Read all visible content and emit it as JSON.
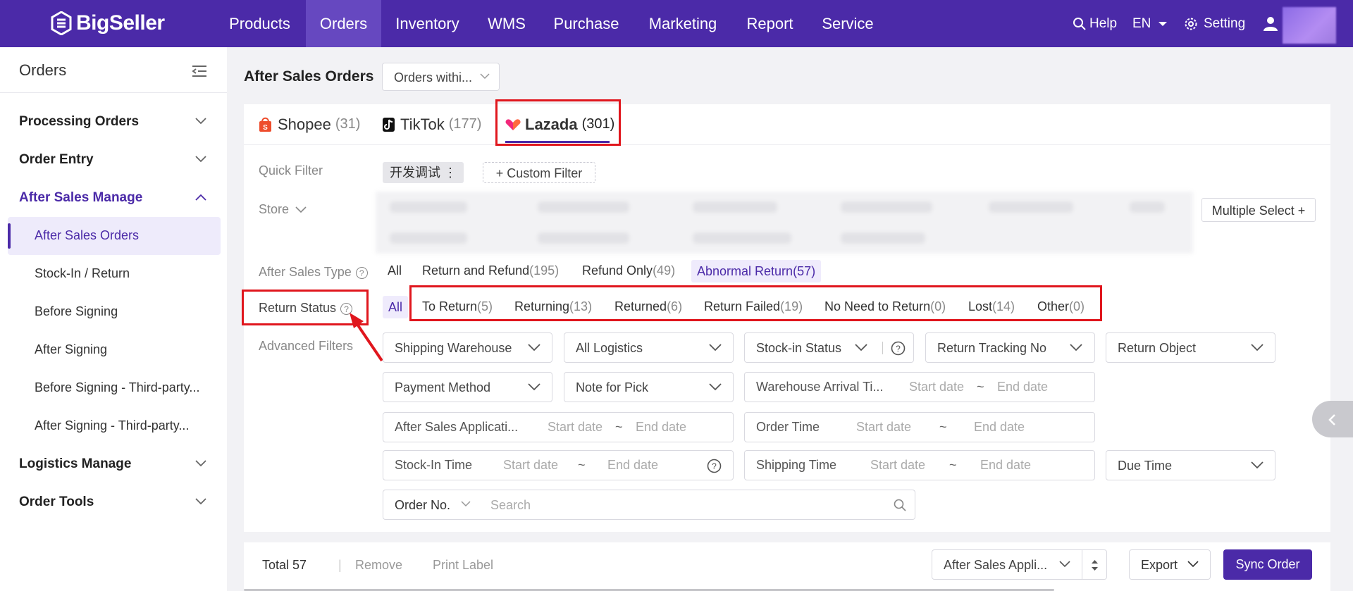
{
  "brand": {
    "name": "BigSeller"
  },
  "topnav": {
    "items": [
      {
        "label": "Products"
      },
      {
        "label": "Orders"
      },
      {
        "label": "Inventory"
      },
      {
        "label": "WMS"
      },
      {
        "label": "Purchase"
      },
      {
        "label": "Marketing"
      },
      {
        "label": "Report"
      },
      {
        "label": "Service"
      }
    ],
    "active": "Orders",
    "help": "Help",
    "lang": "EN",
    "setting": "Setting"
  },
  "sidebar": {
    "title": "Orders",
    "groups": [
      {
        "label": "Processing Orders"
      },
      {
        "label": "Order Entry"
      },
      {
        "label": "After Sales Manage"
      },
      {
        "label": "Logistics Manage"
      },
      {
        "label": "Order Tools"
      }
    ],
    "after_sales_items": [
      {
        "label": "After Sales Orders"
      },
      {
        "label": "Stock-In / Return"
      },
      {
        "label": "Before Signing"
      },
      {
        "label": "After Signing"
      },
      {
        "label": "Before Signing - Third-party..."
      },
      {
        "label": "After Signing - Third-party..."
      }
    ]
  },
  "page": {
    "title": "After Sales Orders",
    "range_select": "Orders withi...",
    "platform_tabs": [
      {
        "name": "Shopee",
        "count": "(31)"
      },
      {
        "name": "TikTok",
        "count": "(177)"
      },
      {
        "name": "Lazada",
        "count": "(301)"
      }
    ]
  },
  "filters": {
    "quick_filter_label": "Quick Filter",
    "quick_tag": "开发调试 ⋮",
    "custom_filter": "+ Custom Filter",
    "store_label": "Store",
    "multiple_select": "Multiple Select +",
    "after_sales_type_label": "After Sales Type",
    "after_sales_types": [
      {
        "label": "All",
        "count": ""
      },
      {
        "label": "Return and Refund",
        "count": "(195)"
      },
      {
        "label": "Refund Only",
        "count": "(49)"
      },
      {
        "label": "Abnormal Return",
        "count": "(57)"
      }
    ],
    "return_status_label": "Return Status",
    "return_statuses": [
      {
        "label": "All",
        "count": ""
      },
      {
        "label": "To Return",
        "count": "(5)"
      },
      {
        "label": "Returning",
        "count": "(13)"
      },
      {
        "label": "Returned",
        "count": "(6)"
      },
      {
        "label": "Return Failed",
        "count": "(19)"
      },
      {
        "label": "No Need to Return",
        "count": "(0)"
      },
      {
        "label": "Lost",
        "count": "(14)"
      },
      {
        "label": "Other",
        "count": "(0)"
      }
    ],
    "advanced_label": "Advanced Filters",
    "selects": {
      "shipping_warehouse": "Shipping Warehouse",
      "all_logistics": "All Logistics",
      "stock_in_status": "Stock-in Status",
      "return_tracking": "Return Tracking No",
      "return_object": "Return Object",
      "payment_method": "Payment Method",
      "note_for_pick": "Note for Pick",
      "due_time": "Due Time",
      "order_no": "Order No."
    },
    "dates": {
      "warehouse_arrival": "Warehouse Arrival Ti...",
      "after_sales_app": "After Sales Applicati...",
      "order_time": "Order Time",
      "stock_in_time": "Stock-In Time",
      "shipping_time": "Shipping Time",
      "start": "Start date",
      "end": "End date",
      "tilde": "~"
    },
    "search_placeholder": "Search"
  },
  "bottom": {
    "total": "Total 57",
    "remove": "Remove",
    "print_label": "Print Label",
    "sort_select": "After Sales Appli...",
    "export": "Export",
    "sync": "Sync Order"
  },
  "colors": {
    "brand": "#4b2aa8",
    "highlight": "#e0161d"
  }
}
